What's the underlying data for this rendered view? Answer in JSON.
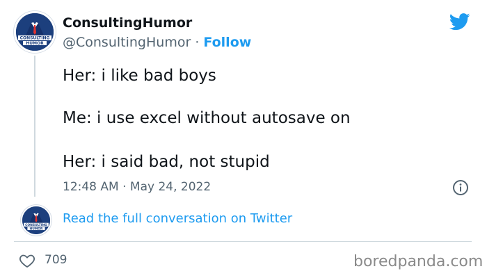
{
  "tweet": {
    "author": {
      "display_name": "ConsultingHumor",
      "handle": "@ConsultingHumor",
      "separator": "·",
      "follow_label": "Follow",
      "avatar_text_line1": "CONSULTING",
      "avatar_text_line2": "HUMOR"
    },
    "lines": [
      "Her: i like bad boys",
      "Me: i use excel without autosave on",
      "Her: i said bad, not stupid"
    ],
    "timestamp": "12:48 AM · May 24, 2022",
    "read_conversation_label": "Read the full conversation on Twitter",
    "likes": "709",
    "icons": {
      "brand": "twitter-bird-icon",
      "info": "info-icon",
      "like": "heart-icon"
    },
    "colors": {
      "accent": "#1d9bf0",
      "text": "#0f1419",
      "muted": "#536471",
      "avatar_bg": "#1c3f7d"
    }
  },
  "watermark": "boredpanda.com"
}
